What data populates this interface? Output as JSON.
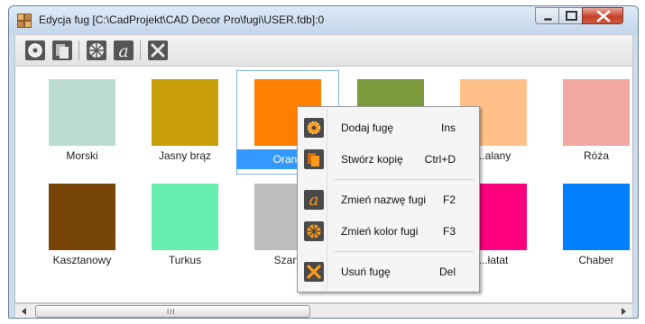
{
  "window": {
    "title": "Edycja fug   [C:\\CadProjekt\\CAD Decor Pro\\fugi\\USER.fdb]:0",
    "app_icon": "joint-editor-icon"
  },
  "toolbar": {
    "buttons": [
      {
        "icon": "add-joint-icon",
        "action": "Dodaj fugę"
      },
      {
        "icon": "copy-icon",
        "action": "Stwórz kopię"
      },
      {
        "icon": "color-wheel-icon",
        "action": "Zmień kolor fugi"
      },
      {
        "icon": "rename-icon",
        "action": "Zmień nazwę fugi"
      },
      {
        "icon": "delete-icon",
        "action": "Usuń fugę"
      }
    ]
  },
  "grid": {
    "selected": "Oranż",
    "tiles": [
      {
        "label": "Morski",
        "color": "#bcdcd2"
      },
      {
        "label": "Jasny brąz",
        "color": "#c9a00c"
      },
      {
        "label": "Oranż",
        "color": "#ff7f00"
      },
      {
        "label": "",
        "color": "#7d9a3c"
      },
      {
        "label": "...alany",
        "color": "#ffc08a"
      },
      {
        "label": "Róża",
        "color": "#f0a8a0"
      },
      {
        "label": "Kasztanowy",
        "color": "#784508"
      },
      {
        "label": "Turkus",
        "color": "#66eeb0"
      },
      {
        "label": "Szary",
        "color": "#bdbdbd"
      },
      {
        "label": "",
        "color": "#2fb6c9"
      },
      {
        "label": "...łatat",
        "color": "#ff007f"
      },
      {
        "label": "Chaber",
        "color": "#0080ff"
      }
    ]
  },
  "context_menu": {
    "items": [
      {
        "label": "Dodaj fugę",
        "shortcut": "Ins",
        "icon": "add-joint-icon"
      },
      {
        "label": "Stwórz kopię",
        "shortcut": "Ctrl+D",
        "icon": "copy-icon"
      },
      {
        "label": "Zmień nazwę fugi",
        "shortcut": "F2",
        "icon": "rename-icon"
      },
      {
        "label": "Zmień kolor fugi",
        "shortcut": "F3",
        "icon": "color-wheel-icon"
      },
      {
        "label": "Usuń fugę",
        "shortcut": "Del",
        "icon": "delete-icon"
      }
    ]
  },
  "scrollbar": {
    "grip": "III"
  }
}
